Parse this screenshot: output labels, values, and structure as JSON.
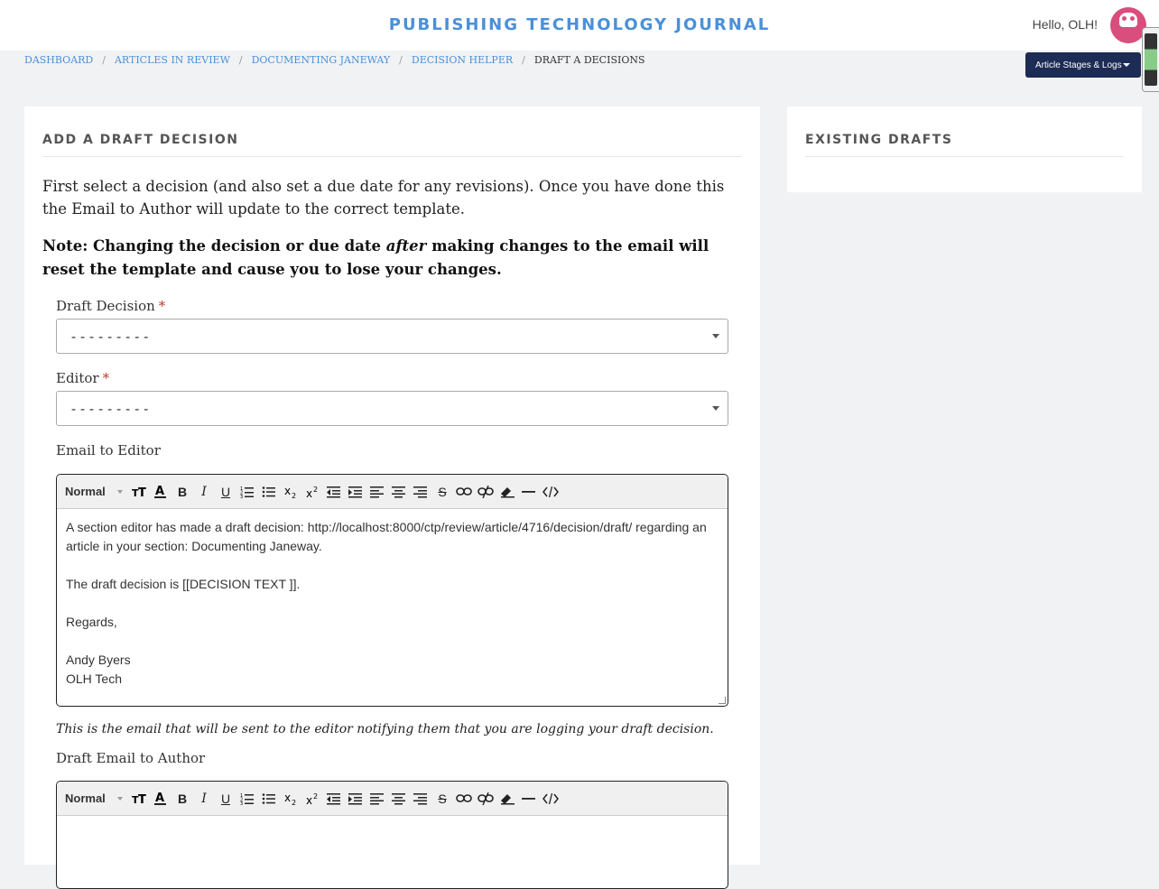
{
  "header": {
    "site_title": "PUBLISHING TECHNOLOGY JOURNAL",
    "greeting": "Hello, OLH!"
  },
  "breadcrumb": [
    "DASHBOARD",
    "ARTICLES IN REVIEW",
    "DOCUMENTING JANEWAY",
    "DECISION HELPER",
    "DRAFT A DECISIONS"
  ],
  "stages_button": "Article Stages & Logs",
  "main": {
    "title": "ADD A DRAFT DECISION",
    "intro": "First select a decision (and also set a due date for any revisions). Once you have done this the Email to Author will update to the correct template.",
    "note_before": "Note: Changing the decision or due date ",
    "note_em": "after",
    "note_after": " making changes to the email will reset the template and cause you to lose your changes.",
    "draft_decision": {
      "label": "Draft Decision",
      "required": "*",
      "value": "---------"
    },
    "editor_field": {
      "label": "Editor",
      "required": "*",
      "value": "---------"
    },
    "email_to_editor": {
      "label": "Email to Editor",
      "format": "Normal",
      "body": [
        "A section editor has made a draft decision: http://localhost:8000/ctp/review/article/4716/decision/draft/ regarding an article in your section: Documenting Janeway.",
        "The draft decision is [[DECISION TEXT ]].",
        "Regards,",
        "Andy Byers",
        "OLH Tech"
      ],
      "help": "This is the email that will be sent to the editor notifying them that you are logging your draft decision."
    },
    "email_to_author": {
      "label": "Draft Email to Author",
      "format": "Normal"
    }
  },
  "side": {
    "title": "EXISTING DRAFTS"
  }
}
